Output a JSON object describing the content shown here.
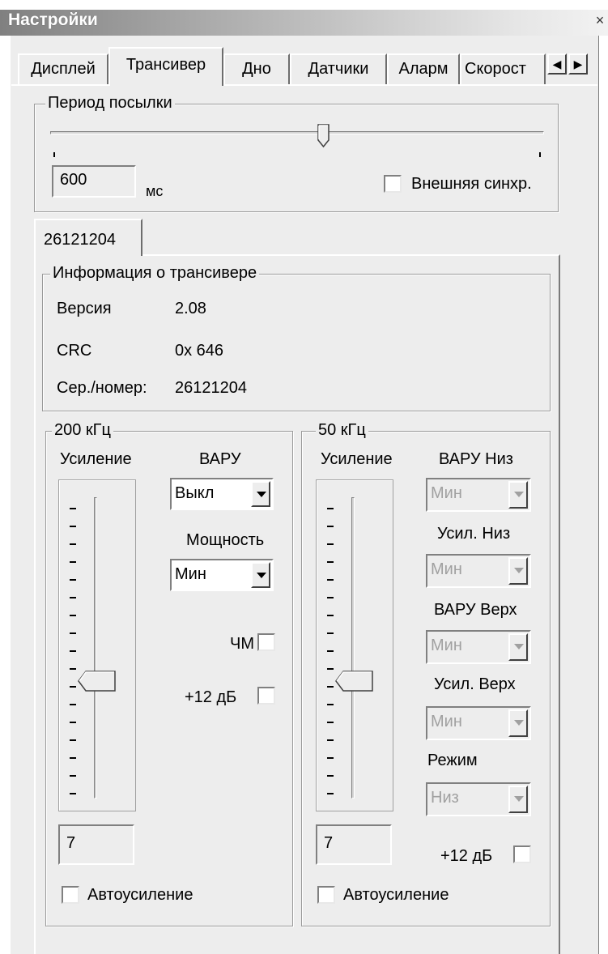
{
  "window": {
    "title": "Настройки",
    "close_glyph": "×"
  },
  "tabs": [
    {
      "label": "Дисплей"
    },
    {
      "label": "Трансивер"
    },
    {
      "label": "Дно"
    },
    {
      "label": "Датчики"
    },
    {
      "label": "Аларм"
    },
    {
      "label": "Скорост"
    }
  ],
  "tab_arrows": {
    "left": "◀",
    "right": "▶"
  },
  "period": {
    "group_label": "Период посылки",
    "value": "600",
    "unit": "мс",
    "ext_sync_label": "Внешняя синхр.",
    "ext_sync_checked": false
  },
  "transceiver_tab": {
    "label": "26121204"
  },
  "info": {
    "group_label": "Информация о трансивере",
    "rows": [
      {
        "key": "Версия",
        "value": "2.08"
      },
      {
        "key": "CRC",
        "value": "0x 646"
      },
      {
        "key": "Сер./номер:",
        "value": "26121204"
      }
    ]
  },
  "freq200": {
    "group_label": "200 кГц",
    "gain_label": "Усиление",
    "varu_label": "ВАРУ",
    "varu_value": "Выкл",
    "power_label": "Мощность",
    "power_value": "Мин",
    "chm_label": "ЧМ",
    "plus12_label": "+12 дБ",
    "gain_value": "7",
    "autogain_label": "Автоусиление"
  },
  "freq50": {
    "group_label": "50 кГц",
    "gain_label": "Усиление",
    "varu_low_label": "ВАРУ Низ",
    "varu_low_value": "Мин",
    "gain_low_label": "Усил. Низ",
    "gain_low_value": "Мин",
    "varu_high_label": "ВАРУ Верх",
    "varu_high_value": "Мин",
    "gain_high_label": "Усил. Верх",
    "gain_high_value": "Мин",
    "mode_label": "Режим",
    "mode_value": "Низ",
    "plus12_label": "+12 дБ",
    "gain_value": "7",
    "autogain_label": "Автоусиление"
  }
}
